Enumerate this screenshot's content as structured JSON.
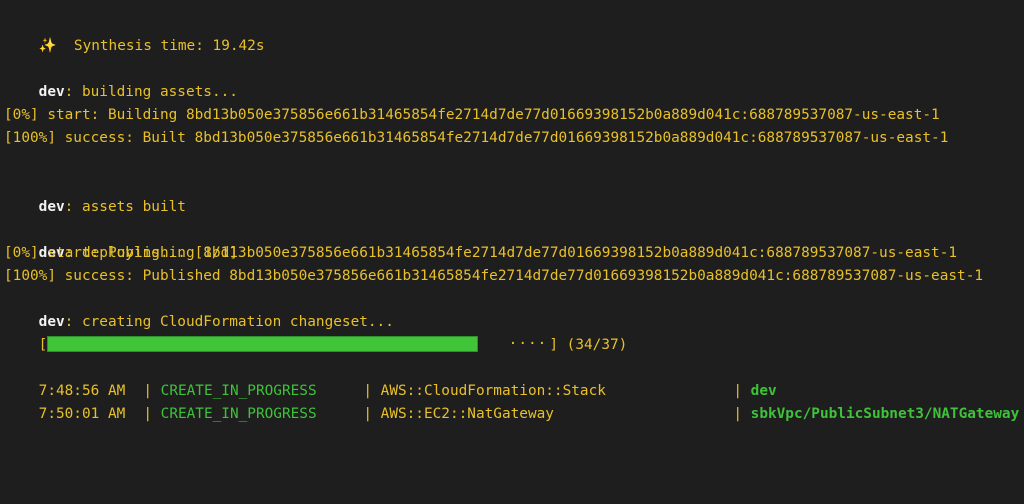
{
  "colors": {
    "background": "#1e1e1e",
    "text_yellow": "#e8c02a",
    "status_green": "#3fc23a",
    "stack_white": "#f2f2f2",
    "progress_fill": "#41c538"
  },
  "synthesis": {
    "icon": "sparkles-icon",
    "icon_glyph": "✨",
    "text": "Synthesis time: 19.42s"
  },
  "stack_name": "dev",
  "build": {
    "building_msg": ": building assets...",
    "start_line": "[0%] start: Building 8bd13b050e375856e661b31465854fe2714d7de77d01669398152b0a889d041c:688789537087-us-east-1",
    "success_line": "[100%] success: Built 8bd13b050e375856e661b31465854fe2714d7de77d01669398152b0a889d041c:688789537087-us-east-1",
    "built_msg": ": assets built"
  },
  "deploy": {
    "deploying_msg": ": deploying... [1/1]",
    "start_line": "[0%] start: Publishing 8bd13b050e375856e661b31465854fe2714d7de77d01669398152b0a889d041c:688789537087-us-east-1",
    "success_line": "[100%] success: Published 8bd13b050e375856e661b31465854fe2714d7de77d01669398152b0a889d041c:688789537087-us-east-1",
    "changeset_msg": ": creating CloudFormation changeset..."
  },
  "progress": {
    "open_bracket": "[",
    "close_bracket": "]",
    "dots": "····",
    "completed": 34,
    "total": 37,
    "label": "(34/37)"
  },
  "events": [
    {
      "time": "7:48:56 AM",
      "sep1": " | ",
      "status": "CREATE_IN_PROGRESS",
      "sep2": " | ",
      "resource_type": "AWS::CloudFormation::Stack",
      "sep3": " | ",
      "logical_id": "dev"
    },
    {
      "time": "7:50:01 AM",
      "sep1": " | ",
      "status": "CREATE_IN_PROGRESS",
      "sep2": " | ",
      "resource_type": "AWS::EC2::NatGateway",
      "sep3": " | ",
      "logical_id": "sbkVpc/PublicSubnet3/NATGateway"
    }
  ]
}
